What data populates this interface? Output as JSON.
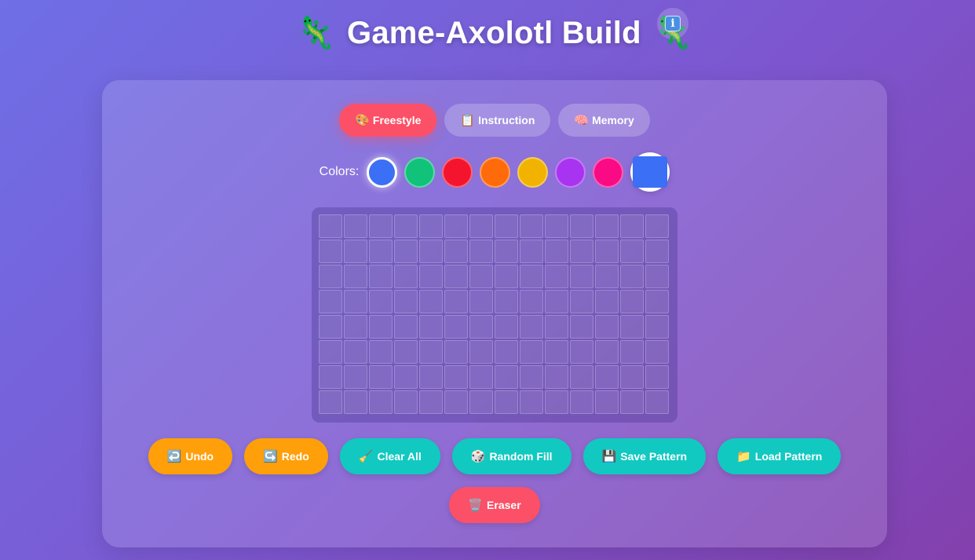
{
  "header": {
    "title": "Game-Axolotl Build",
    "left_icon": "🦎",
    "right_icon": "🦎",
    "info_icon": "i"
  },
  "modes": [
    {
      "icon": "🎨",
      "label": "Freestyle",
      "active": true
    },
    {
      "icon": "📋",
      "label": "Instruction",
      "active": false
    },
    {
      "icon": "🧠",
      "label": "Memory",
      "active": false
    }
  ],
  "colors": {
    "label": "Colors:",
    "swatches": [
      "#3b6ff5",
      "#10c27a",
      "#f5142e",
      "#ff6a0a",
      "#f2b300",
      "#a833f0",
      "#fb0a86"
    ],
    "selected": "#3b6ff5",
    "custom": "#3b6ff5"
  },
  "grid": {
    "rows": 8,
    "cols": 14
  },
  "actions": [
    {
      "icon": "↩️",
      "label": "Undo",
      "style": "orange"
    },
    {
      "icon": "↪️",
      "label": "Redo",
      "style": "orange"
    },
    {
      "icon": "🧹",
      "label": "Clear All",
      "style": "teal"
    },
    {
      "icon": "🎲",
      "label": "Random Fill",
      "style": "teal"
    },
    {
      "icon": "💾",
      "label": "Save Pattern",
      "style": "teal"
    },
    {
      "icon": "📁",
      "label": "Load Pattern",
      "style": "teal"
    }
  ],
  "eraser": {
    "icon": "🗑️",
    "label": "Eraser",
    "style": "red"
  }
}
